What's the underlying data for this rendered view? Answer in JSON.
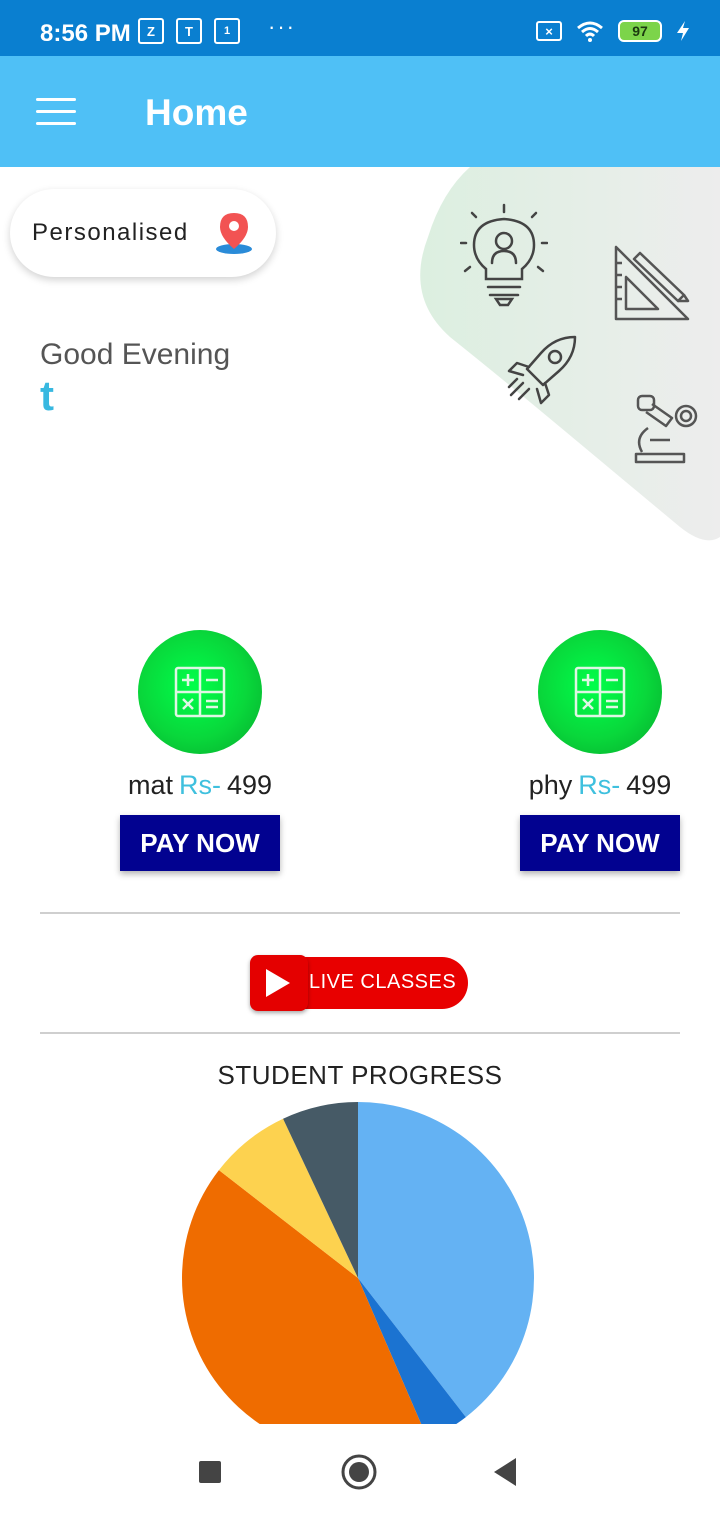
{
  "status_bar": {
    "time": "8:56 PM",
    "battery": "97",
    "icons": [
      "zoom-icon",
      "teams-icon",
      "calendar-icon",
      "more-dots-icon",
      "sim-x-icon",
      "wifi-icon",
      "battery-icon",
      "charging-icon"
    ]
  },
  "app_bar": {
    "title": "Home",
    "menu_icon": "hamburger-menu-icon"
  },
  "hero": {
    "personalised_label": "Personalised",
    "greeting": "Good Evening",
    "username": "t",
    "icons": [
      "lightbulb-icon",
      "ruler-pencil-icon",
      "rocket-icon",
      "microscope-icon"
    ]
  },
  "courses": [
    {
      "name": "mat",
      "currency": "Rs-",
      "price": "499",
      "button": "PAY NOW",
      "icon": "calculator-icon"
    },
    {
      "name": "phy",
      "currency": "Rs-",
      "price": "499",
      "button": "PAY NOW",
      "icon": "calculator-icon"
    }
  ],
  "live_classes": {
    "label": "LIVE CLASSES",
    "icon": "play-icon"
  },
  "progress": {
    "title": "STUDENT PROGRESS"
  },
  "chart_data": {
    "type": "pie",
    "title": "STUDENT PROGRESS",
    "values": [
      39.5,
      4,
      42,
      7.5,
      7
    ],
    "colors": [
      "#64b2f3",
      "#1b73d1",
      "#ef6c00",
      "#fdd24f",
      "#465a66"
    ]
  },
  "colors": {
    "status_bar": "#0a7fd0",
    "app_bar": "#4fc0f6",
    "pay_button": "#020290",
    "course_icon": "#09d73b",
    "live": "#e80000",
    "accent_text": "#3fc0de"
  },
  "nav_bar": {
    "icons": [
      "recents-square-icon",
      "home-circle-icon",
      "back-triangle-icon"
    ]
  }
}
